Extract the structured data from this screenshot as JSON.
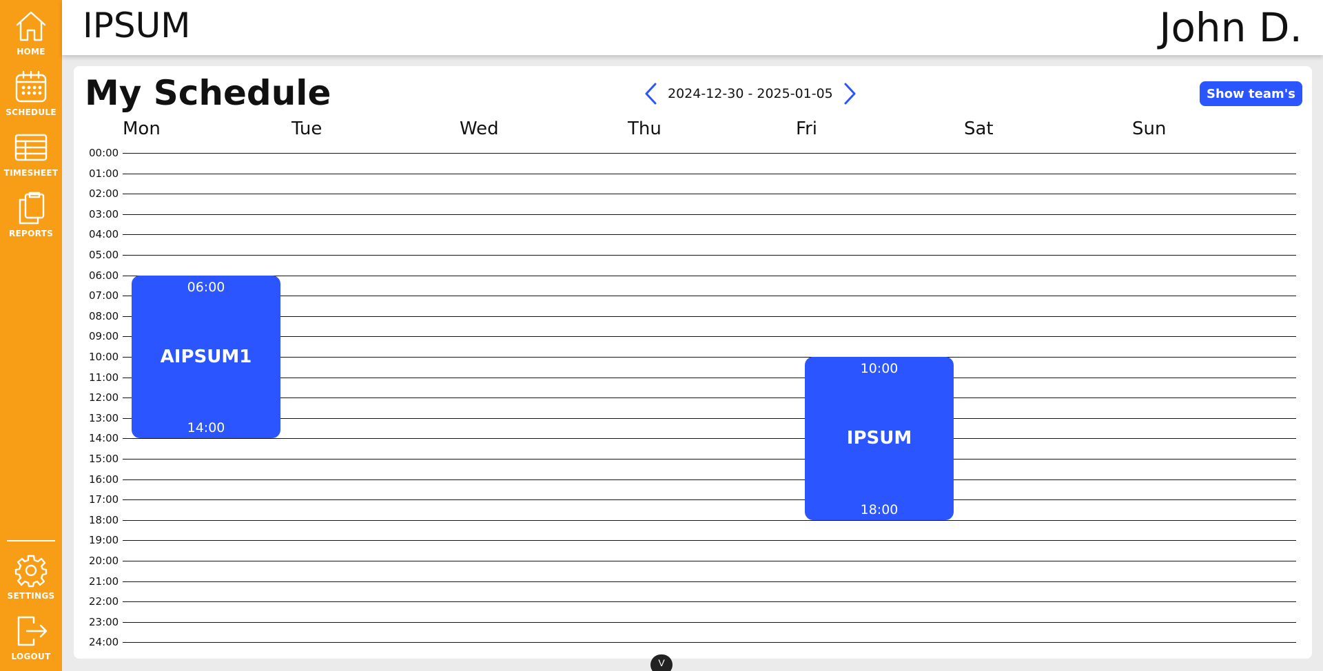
{
  "sidebar": {
    "items": [
      {
        "label": "HOME",
        "icon": "home-icon"
      },
      {
        "label": "SCHEDULE",
        "icon": "calendar-icon"
      },
      {
        "label": "TIMESHEET",
        "icon": "table-icon"
      },
      {
        "label": "REPORTS",
        "icon": "clipboard-icon"
      },
      {
        "label": "SETTINGS",
        "icon": "gear-icon"
      },
      {
        "label": "LOGOUT",
        "icon": "logout-icon"
      }
    ]
  },
  "header": {
    "app_title": "IPSUM",
    "user_name": "John D."
  },
  "schedule": {
    "title": "My Schedule",
    "week_range": "2024-12-30 - 2025-01-05",
    "show_team_label": "Show team's",
    "days": [
      "Mon",
      "Tue",
      "Wed",
      "Thu",
      "Fri",
      "Sat",
      "Sun"
    ],
    "hours": [
      "00:00",
      "01:00",
      "02:00",
      "03:00",
      "04:00",
      "05:00",
      "06:00",
      "07:00",
      "08:00",
      "09:00",
      "10:00",
      "11:00",
      "12:00",
      "13:00",
      "14:00",
      "15:00",
      "16:00",
      "17:00",
      "18:00",
      "19:00",
      "20:00",
      "21:00",
      "22:00",
      "23:00",
      "24:00"
    ],
    "events": [
      {
        "day": "Mon",
        "title": "AIPSUM1",
        "start": "06:00",
        "end": "14:00"
      },
      {
        "day": "Fri",
        "title": "IPSUM",
        "start": "10:00",
        "end": "18:00"
      }
    ]
  },
  "colors": {
    "sidebar": "#f89e16",
    "accent": "#2a55ff"
  },
  "scroll_handle_glyph": "V"
}
